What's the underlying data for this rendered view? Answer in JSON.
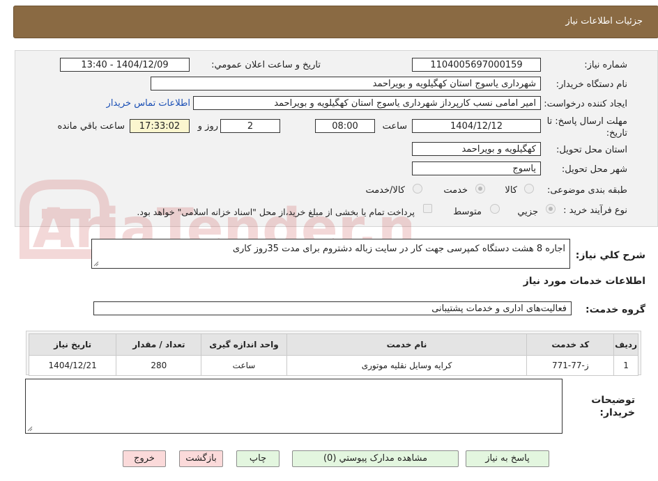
{
  "header": {
    "title": "جزئیات اطلاعات نیاز"
  },
  "fields": {
    "need_number_label": "شماره نیاز:",
    "need_number": "1104005697000159",
    "announce_label": "تاريخ و ساعت اعلان عمومي:",
    "announce_value": "1404/12/09 - 13:40",
    "buyer_label": "نام دستگاه خريدار:",
    "buyer_value": "شهرداری یاسوج استان کهگیلویه و بویراحمد",
    "creator_label": "ایجاد کننده درخواست:",
    "creator_value": "امیر امامی نسب کارپرداز شهرداری یاسوج استان کهگیلویه و بویراحمد",
    "contact_link": "اطلاعات تماس خریدار",
    "deadline_label_1": "مهلت ارسال پاسخ: تا",
    "deadline_label_2": "تاريخ:",
    "deadline_date": "1404/12/12",
    "hour_label": "ساعت",
    "deadline_hour": "08:00",
    "days_value": "2",
    "days_label": "روز و",
    "remaining_time": "17:33:02",
    "remaining_label": "ساعت باقي مانده",
    "province_label": "استان محل تحویل:",
    "province_value": "کهگیلویه و بویراحمد",
    "city_label": "شهر محل تحویل:",
    "city_value": "یاسوج",
    "category_label": "طبقه بندی موضوعی:",
    "category_options": [
      "کالا",
      "خدمت",
      "کالا/خدمت"
    ],
    "category_selected": "خدمت",
    "process_label": "نوع فرآیند خرید :",
    "process_options": [
      "جزيي",
      "متوسط"
    ],
    "process_selected": "جزيي",
    "payment_note": "پرداخت تمام یا بخشی از مبلغ خرید،از محل \"اسناد خزانه اسلامی\" خواهد بود.",
    "general_desc_label": "شرح کلي نياز:",
    "general_desc_value": "اجاره 8 هشت دستگاه کمپرسی جهت کار در سایت زباله دشتروم برای مدت 35روز کاری",
    "services_title": "اطلاعات خدمات مورد نياز",
    "service_group_label": "گروه خدمت:",
    "service_group_value": "فعالیت‌های اداری و خدمات پشتیبانی",
    "buyer_notes_label_1": "توضيحات",
    "buyer_notes_label_2": "خريدار:"
  },
  "table": {
    "headers": [
      "رديف",
      "کد خدمت",
      "نام خدمت",
      "واحد اندازه گیری",
      "تعداد / مقدار",
      "تاريخ نياز"
    ],
    "rows": [
      [
        "1",
        "ز-77-771",
        "کرایه وسایل نقلیه موتوری",
        "ساعت",
        "280",
        "1404/12/21"
      ]
    ]
  },
  "buttons": {
    "reply": "پاسخ به نياز",
    "docs": "مشاهده مدارک پیوستي (0)",
    "print": "چاپ",
    "back": "بازگشت",
    "exit": "خروج"
  },
  "watermark": {
    "text": "AriaTender.neT"
  },
  "colors": {
    "header_bg": "#8a6a43",
    "yellow_box": "#fbf6cf",
    "green_btn": "#e3f6df",
    "pink_btn": "#fbdada",
    "link": "#1a4fb5"
  }
}
